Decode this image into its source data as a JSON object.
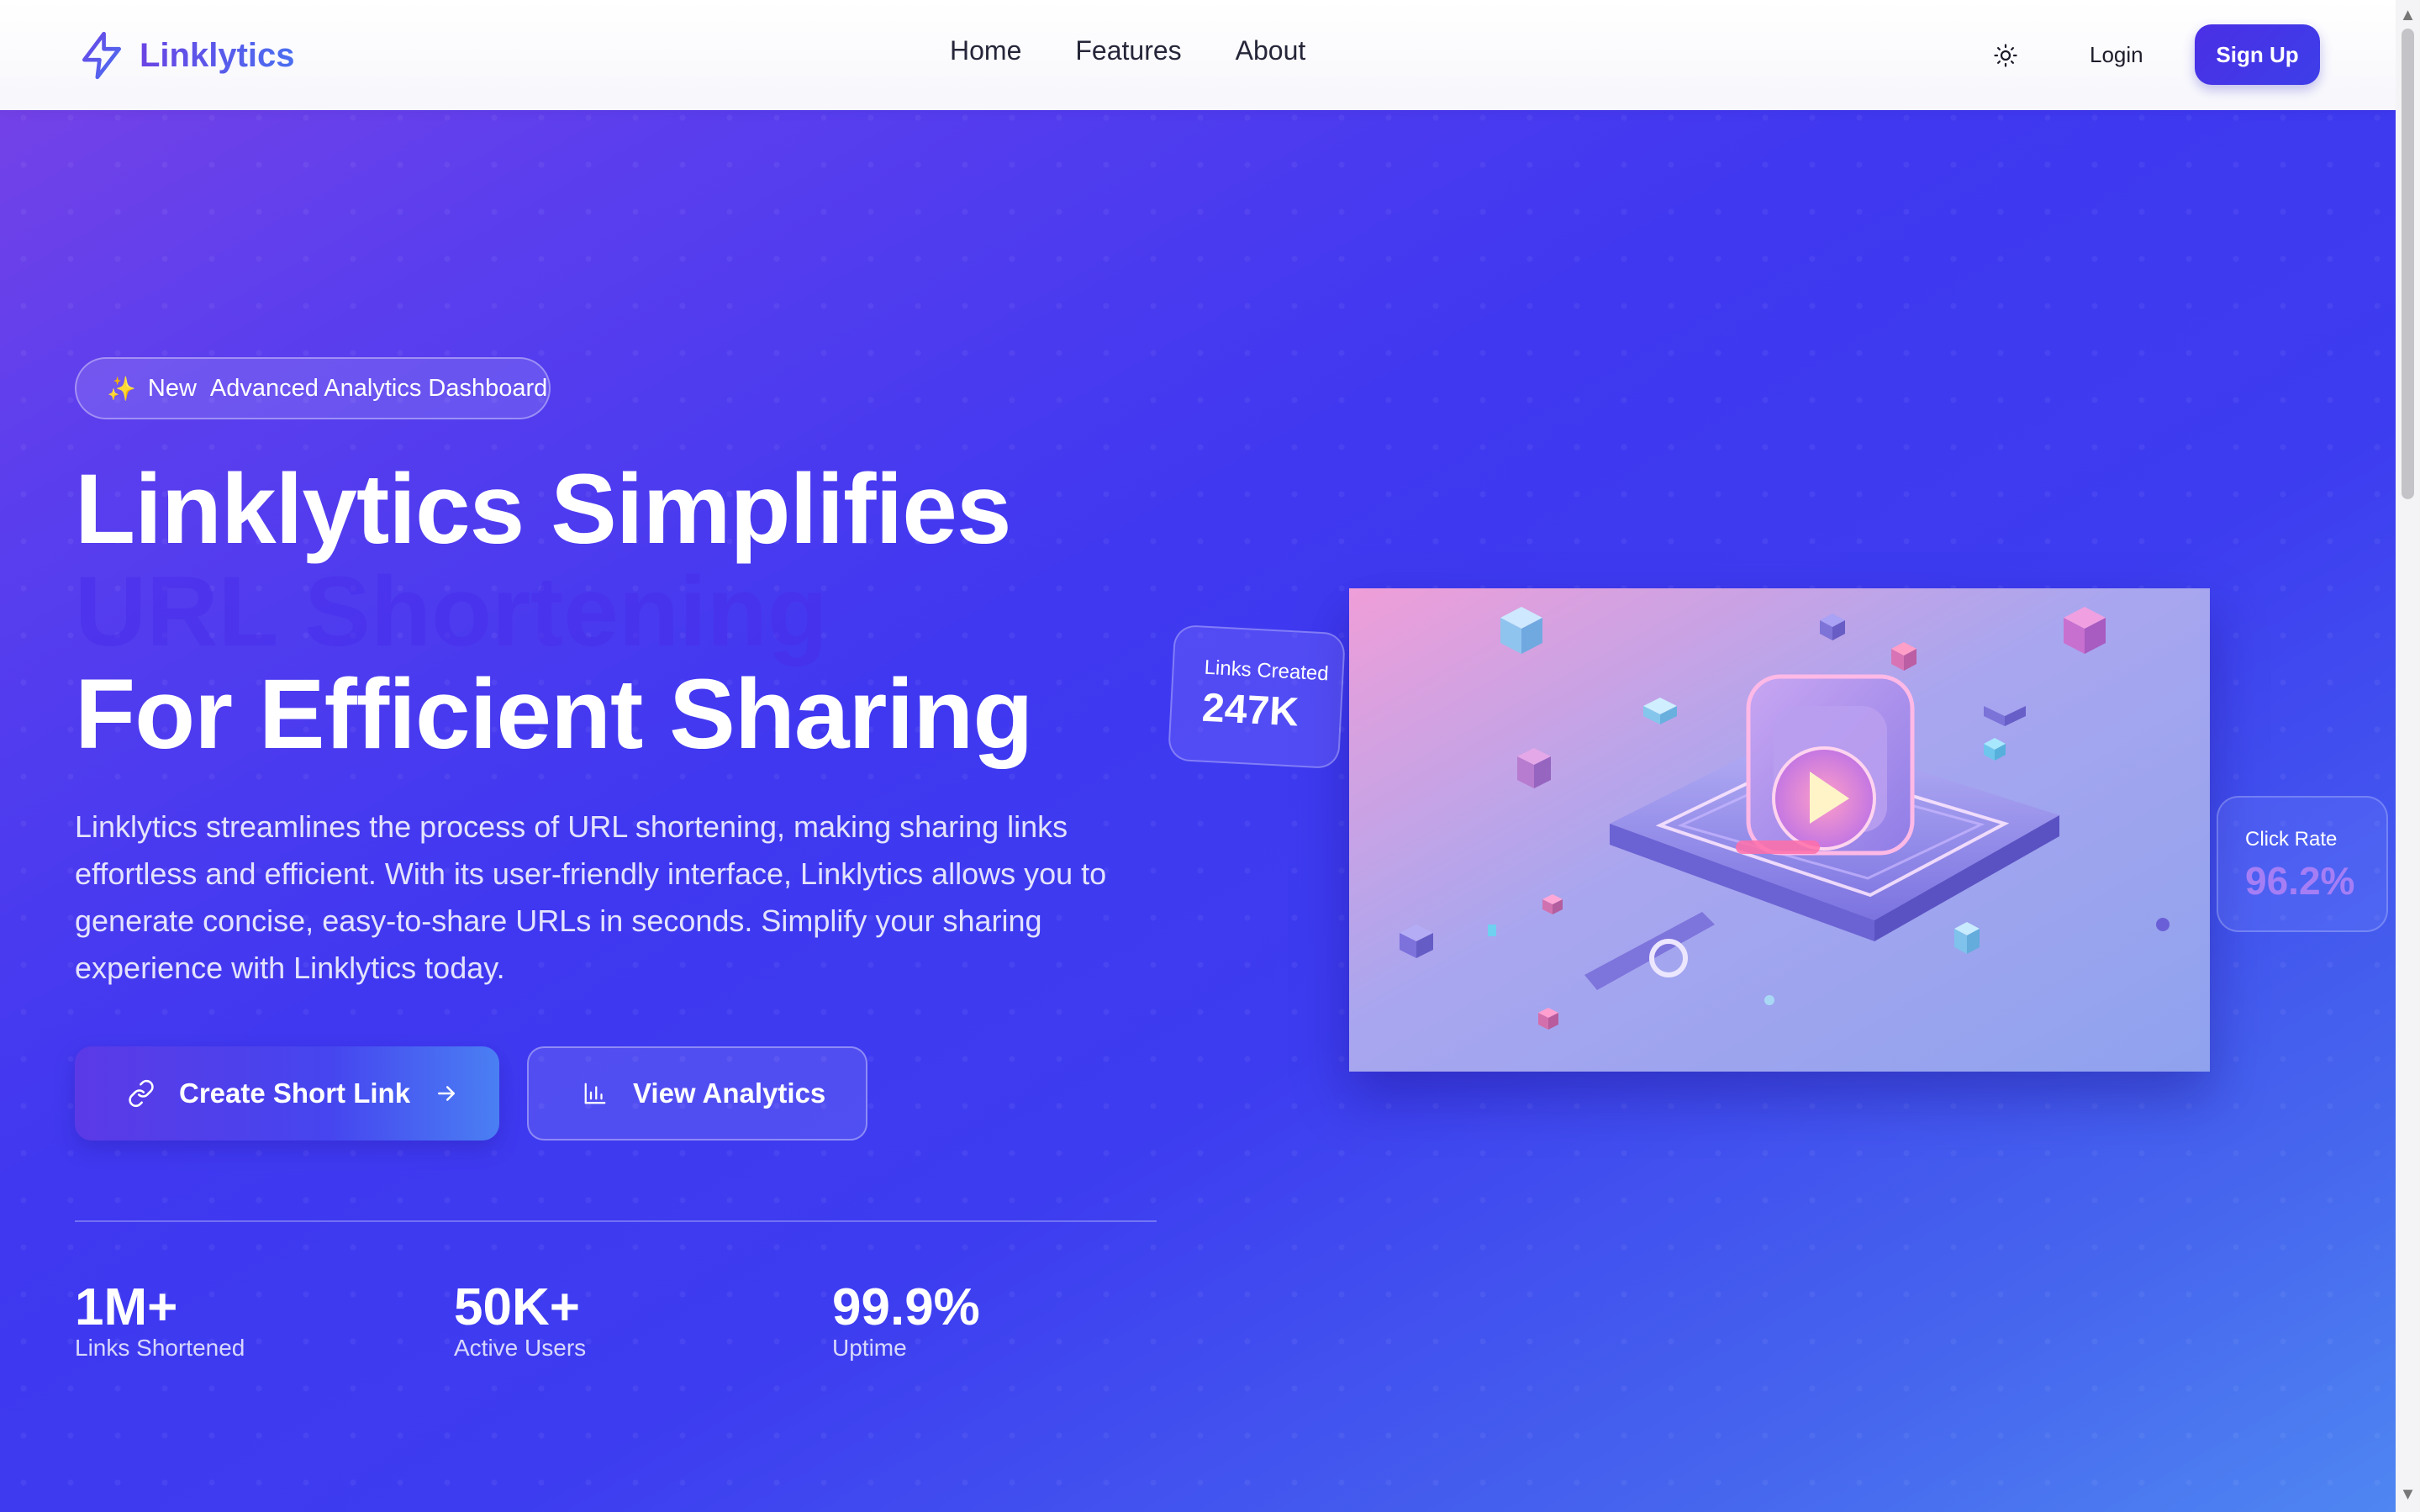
{
  "nav": {
    "brand": "Linklytics",
    "links": [
      "Home",
      "Features",
      "About"
    ],
    "login": "Login",
    "signup": "Sign Up"
  },
  "hero": {
    "badge_new": "New",
    "badge_text": "Advanced Analytics Dashboard",
    "headline_line1": "Linklytics Simplifies",
    "headline_line2": "URL Shortening",
    "headline_line3": "For Efficient Sharing",
    "description": "Linklytics streamlines the process of URL shortening, making sharing links effortless and efficient. With its user-friendly interface, Linklytics allows you to generate concise, easy-to-share URLs in seconds. Simplify your sharing experience with Linklytics today.",
    "primary_button": "Create Short Link",
    "secondary_button": "View Analytics"
  },
  "stats": [
    {
      "value": "1M+",
      "label": "Links Shortened"
    },
    {
      "value": "50K+",
      "label": "Active Users"
    },
    {
      "value": "99.9%",
      "label": "Uptime"
    }
  ],
  "cards": {
    "links_created_title": "Links Created",
    "links_created_value": "247K",
    "click_rate_title": "Click Rate",
    "click_rate_value": "96.2%"
  },
  "icons": {
    "brand": "lightning-bolt-icon",
    "theme": "sun-icon",
    "badge": "sparkles-icon",
    "primary_left": "link-icon",
    "primary_right": "arrow-right-icon",
    "secondary_left": "bar-chart-icon"
  },
  "colors": {
    "accent": "#4b2fe6",
    "hero_gradient_start": "#7a43e6",
    "hero_gradient_mid": "#3f38f0",
    "hero_gradient_end": "#4f86f2",
    "click_rate_value": "#a57ef5"
  }
}
